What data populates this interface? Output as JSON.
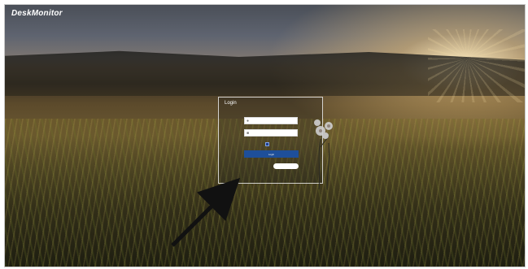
{
  "header": {
    "logo_text": "DeskMonitor",
    "top_right_link": ""
  },
  "login": {
    "title": "Login",
    "username": {
      "placeholder": "",
      "icon": "user-icon"
    },
    "password": {
      "placeholder": "",
      "icon": "lock-icon"
    },
    "remember_label": "",
    "login_button": "Login",
    "forgot_link": "",
    "signup_button": "",
    "extra_link": ""
  },
  "colors": {
    "accent": "#1e4f9a"
  }
}
